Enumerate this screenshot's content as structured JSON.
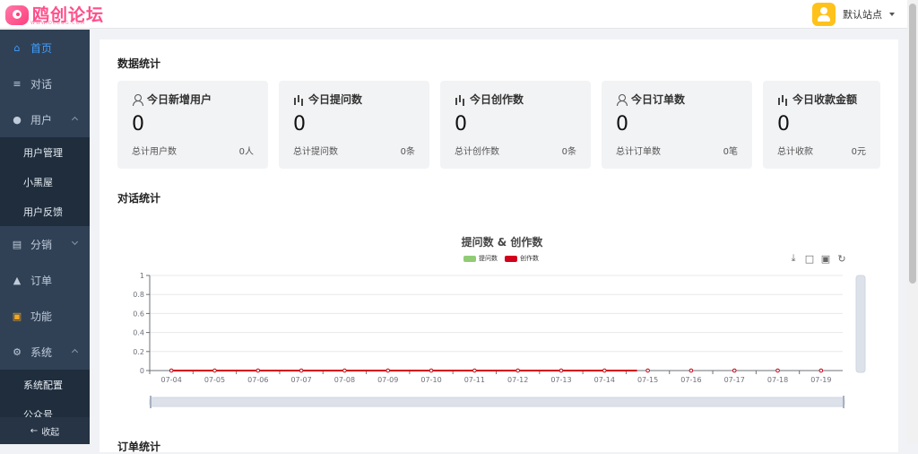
{
  "header": {
    "logo_text": "鸥创论坛",
    "logo_sub": "WWW.OCUGG.COM",
    "site_selector": "默认站点"
  },
  "sidebar": {
    "items": [
      {
        "label": "首页",
        "icon": "home-icon",
        "active": true
      },
      {
        "label": "对话",
        "icon": "list-icon"
      },
      {
        "label": "用户",
        "icon": "user-icon",
        "expanded": true,
        "children": [
          "用户管理",
          "小黑屋",
          "用户反馈"
        ]
      },
      {
        "label": "分销",
        "icon": "share-icon",
        "expanded": false
      },
      {
        "label": "订单",
        "icon": "money-bag-icon"
      },
      {
        "label": "功能",
        "icon": "grid-icon"
      },
      {
        "label": "系统",
        "icon": "gear-icon",
        "expanded": true,
        "children": [
          "系统配置",
          "公众号"
        ]
      }
    ],
    "collapse_label": "收起"
  },
  "dashboard": {
    "section_stats_title": "数据统计",
    "section_chat_title": "对话统计",
    "section_bottom_title": "订单统计",
    "cards": [
      {
        "title": "今日新增用户",
        "icon": "user-icon",
        "value": "0",
        "footer_label": "总计用户数",
        "footer_value": "0人"
      },
      {
        "title": "今日提问数",
        "icon": "bar-chart-icon",
        "value": "0",
        "footer_label": "总计提问数",
        "footer_value": "0条"
      },
      {
        "title": "今日创作数",
        "icon": "bar-chart-icon",
        "value": "0",
        "footer_label": "总计创作数",
        "footer_value": "0条"
      },
      {
        "title": "今日订单数",
        "icon": "user-icon",
        "value": "0",
        "footer_label": "总计订单数",
        "footer_value": "0笔"
      },
      {
        "title": "今日收款金额",
        "icon": "bar-chart-icon",
        "value": "0",
        "footer_label": "总计收款",
        "footer_value": "0元"
      }
    ]
  },
  "chart_data": {
    "type": "line",
    "title": "提问数 & 创作数",
    "categories": [
      "07-04",
      "07-05",
      "07-06",
      "07-07",
      "07-08",
      "07-09",
      "07-10",
      "07-11",
      "07-12",
      "07-13",
      "07-14",
      "07-15",
      "07-16",
      "07-17",
      "07-18",
      "07-19"
    ],
    "series": [
      {
        "name": "提问数",
        "color": "#91cc75",
        "values": [
          0,
          0,
          0,
          0,
          0,
          0,
          0,
          0,
          0,
          0,
          0,
          0,
          0,
          0,
          0,
          0
        ]
      },
      {
        "name": "创作数",
        "color": "#d3001e",
        "values": [
          0,
          0,
          0,
          0,
          0,
          0,
          0,
          0,
          0,
          0,
          0,
          0,
          0,
          0,
          0,
          0
        ]
      }
    ],
    "yticks": [
      "0",
      "0.2",
      "0.4",
      "0.6",
      "0.8",
      "1"
    ],
    "ylim": [
      0,
      1
    ],
    "legend": "top-center",
    "grid": true,
    "toolbox": [
      "download-icon",
      "zoom-icon",
      "zoom-reset-icon",
      "refresh-icon"
    ]
  }
}
